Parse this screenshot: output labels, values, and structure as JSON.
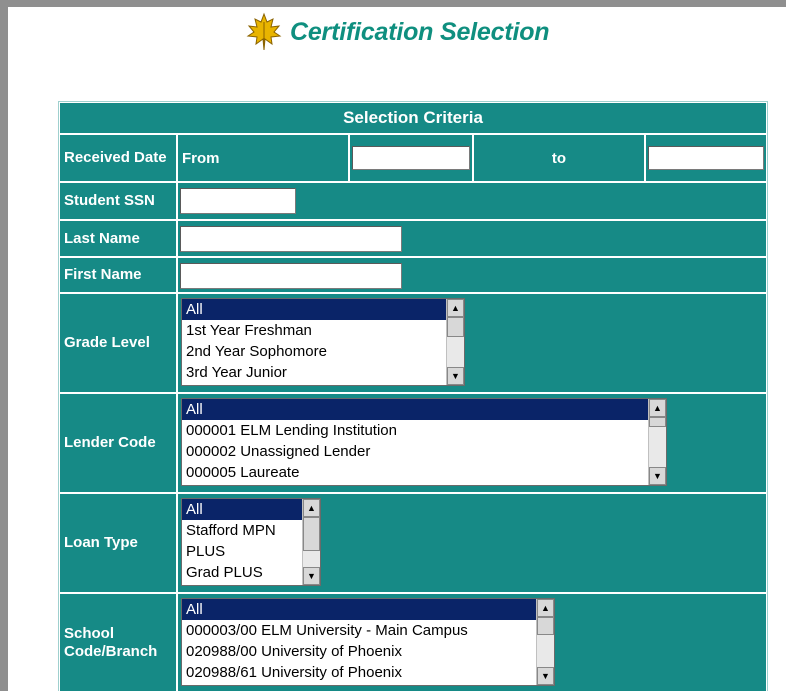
{
  "header": {
    "title": "Certification Selection",
    "logo_icon": "maple-leaf-icon"
  },
  "criteria": {
    "heading": "Selection Criteria",
    "received_date": {
      "label": "Received Date",
      "from_label": "From",
      "to_label": "to",
      "from_value": "",
      "to_value": ""
    },
    "student_ssn": {
      "label": "Student SSN",
      "value": ""
    },
    "last_name": {
      "label": "Last Name",
      "value": ""
    },
    "first_name": {
      "label": "First Name",
      "value": ""
    },
    "grade_level": {
      "label": "Grade Level",
      "options": [
        "All",
        "1st Year Freshman",
        "2nd Year Sophomore",
        "3rd Year Junior"
      ],
      "selected": "All"
    },
    "lender_code": {
      "label": "Lender Code",
      "options": [
        "All",
        "000001 ELM Lending Institution",
        "000002 Unassigned Lender",
        "000005 Laureate"
      ],
      "selected": "All"
    },
    "loan_type": {
      "label": "Loan Type",
      "options": [
        "All",
        "Stafford MPN",
        "PLUS",
        "Grad PLUS"
      ],
      "selected": "All"
    },
    "school_code": {
      "label": "School Code/Branch",
      "options": [
        "All",
        "000003/00 ELM University - Main Campus",
        "020988/00 University of Phoenix",
        "020988/61 University of Phoenix"
      ],
      "selected": "All"
    }
  },
  "colors": {
    "teal": "#168a86",
    "title_green": "#0f8f7f",
    "selection_navy": "#0a2468"
  }
}
